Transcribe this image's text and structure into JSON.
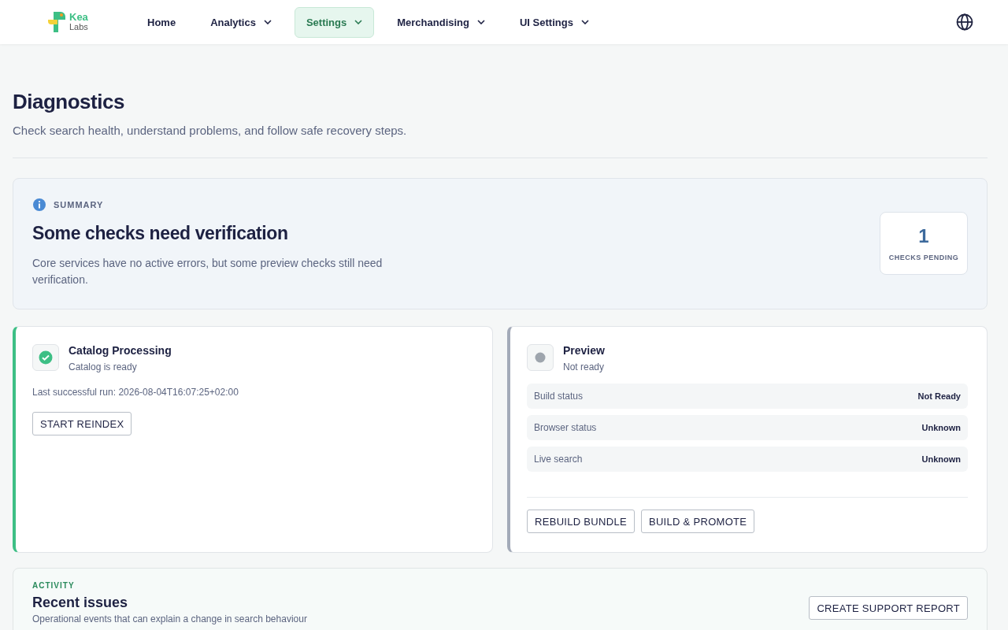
{
  "logo": {
    "line1": "Kea",
    "line2": "Labs"
  },
  "nav": [
    {
      "label": "Home",
      "dropdown": false,
      "selected": false
    },
    {
      "label": "Analytics",
      "dropdown": true,
      "selected": false
    },
    {
      "label": "Settings",
      "dropdown": true,
      "selected": true
    },
    {
      "label": "Merchandising",
      "dropdown": true,
      "selected": false
    },
    {
      "label": "UI Settings",
      "dropdown": true,
      "selected": false
    }
  ],
  "page": {
    "title": "Diagnostics",
    "subtitle": "Check search health, understand problems, and follow safe recovery steps."
  },
  "summary": {
    "eyebrow": "SUMMARY",
    "title": "Some checks need verification",
    "text": "Core services have no active errors, but some preview checks still need verification.",
    "count": "1",
    "count_label": "CHECKS PENDING"
  },
  "cards": [
    {
      "title": "Catalog Processing",
      "kind": "ok",
      "status_text": "Catalog is ready",
      "note": "Last successful run: 2026-08-04T16:07:25+02:00",
      "buttons": [
        "START REINDEX"
      ]
    },
    {
      "title": "Preview",
      "kind": "unknown",
      "status_text": "Not ready",
      "rows": [
        {
          "label": "Build status",
          "value": "Not Ready"
        },
        {
          "label": "Browser status",
          "value": "Unknown"
        },
        {
          "label": "Live search",
          "value": "Unknown"
        }
      ],
      "buttons": [
        "REBUILD BUNDLE",
        "BUILD & PROMOTE"
      ]
    }
  ],
  "activity": {
    "eyebrow": "ACTIVITY",
    "title": "Recent issues",
    "text": "Operational events that can explain a change in search behaviour",
    "button": "CREATE SUPPORT REPORT"
  }
}
